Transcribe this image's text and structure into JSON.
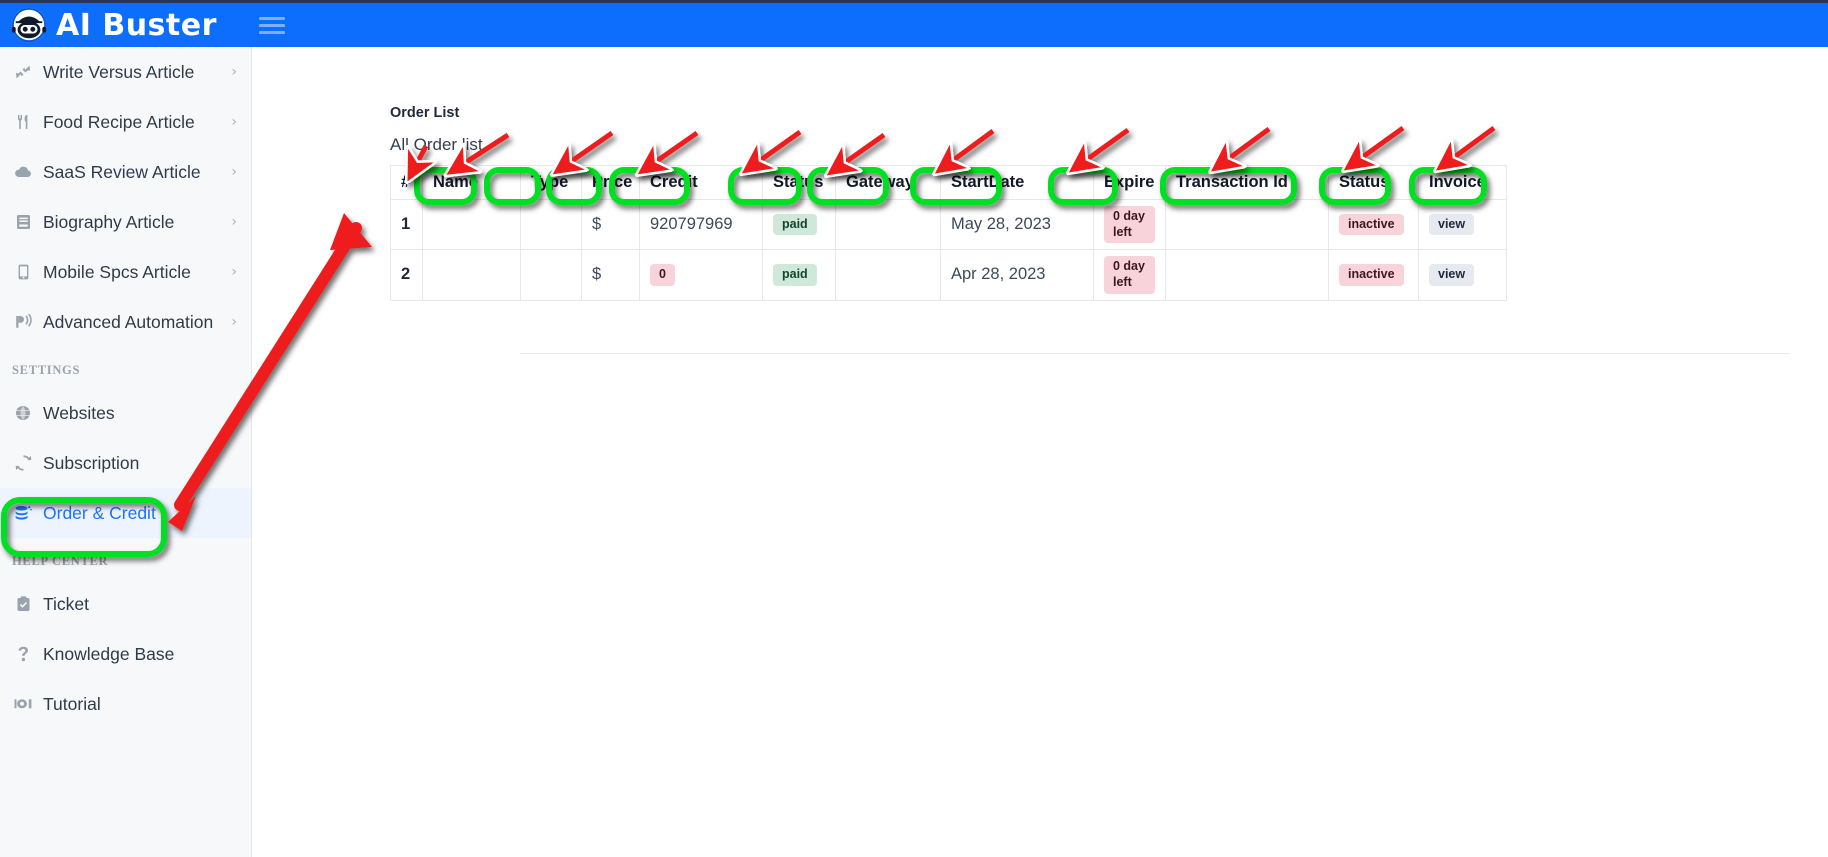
{
  "header": {
    "brand": "AI Buster",
    "logo_icon": "robot-logo-icon",
    "menu_icon": "hamburger-menu-icon",
    "brand_color": "#0d6efd"
  },
  "sidebar": {
    "items": [
      {
        "label": "Write Versus Article",
        "icon": "arrows-collapse-icon",
        "has_chevron": true,
        "active": false
      },
      {
        "label": "Food Recipe Article",
        "icon": "fork-knife-icon",
        "has_chevron": true,
        "active": false
      },
      {
        "label": "SaaS Review Article",
        "icon": "cloud-icon",
        "has_chevron": true,
        "active": false
      },
      {
        "label": "Biography Article",
        "icon": "book-icon",
        "has_chevron": true,
        "active": false
      },
      {
        "label": "Mobile Spcs Article",
        "icon": "mobile-phone-icon",
        "has_chevron": true,
        "active": false
      },
      {
        "label": "Advanced Automation",
        "icon": "broadcast-icon",
        "has_chevron": true,
        "active": false
      }
    ],
    "settings_label": "SETTINGS",
    "settings_items": [
      {
        "label": "Websites",
        "icon": "globe-icon",
        "active": false
      },
      {
        "label": "Subscription",
        "icon": "refresh-cycle-icon",
        "active": false
      },
      {
        "label": "Order & Credit",
        "icon": "coins-stack-icon",
        "active": true
      }
    ],
    "help_label": "HELP CENTER",
    "help_items": [
      {
        "label": "Ticket",
        "icon": "clipboard-check-icon"
      },
      {
        "label": "Knowledge Base",
        "icon": "question-mark-icon"
      },
      {
        "label": "Tutorial",
        "icon": "video-camera-icon"
      }
    ],
    "active_color": "#1a73ff",
    "active_bg": "#eef4fe"
  },
  "main": {
    "panel_title": "Order List",
    "panel_subtitle": "All Order list",
    "table": {
      "columns": [
        "#",
        "Name",
        "Type",
        "Price",
        "Credit",
        "Status",
        "Gateway",
        "StartDate",
        "Expire",
        "Transaction Id",
        "Status",
        "Invoice"
      ],
      "rows": [
        {
          "index": "1",
          "name": "",
          "type": "",
          "price": "$",
          "credit": "920797969",
          "credit_badge": false,
          "status": "paid",
          "gateway": "",
          "start_date": "May 28, 2023",
          "expire": "0 day left",
          "transaction_id": "",
          "status2": "inactive",
          "invoice": "view"
        },
        {
          "index": "2",
          "name": "",
          "type": "",
          "price": "$",
          "credit": "0",
          "credit_badge": true,
          "status": "paid",
          "gateway": "",
          "start_date": "Apr 28, 2023",
          "expire": "0 day left",
          "transaction_id": "",
          "status2": "inactive",
          "invoice": "view"
        }
      ]
    }
  },
  "annotations": {
    "highlight_color": "#00e021",
    "arrow_color": "#ee1c1c",
    "highlighted_targets": [
      "sidebar-item-order-credit",
      "column-header-name",
      "column-header-type",
      "column-header-price",
      "column-header-credit",
      "column-header-status",
      "column-header-gateway",
      "column-header-startdate",
      "column-header-expire",
      "column-header-transaction-id",
      "column-header-status-2",
      "column-header-invoice"
    ]
  }
}
